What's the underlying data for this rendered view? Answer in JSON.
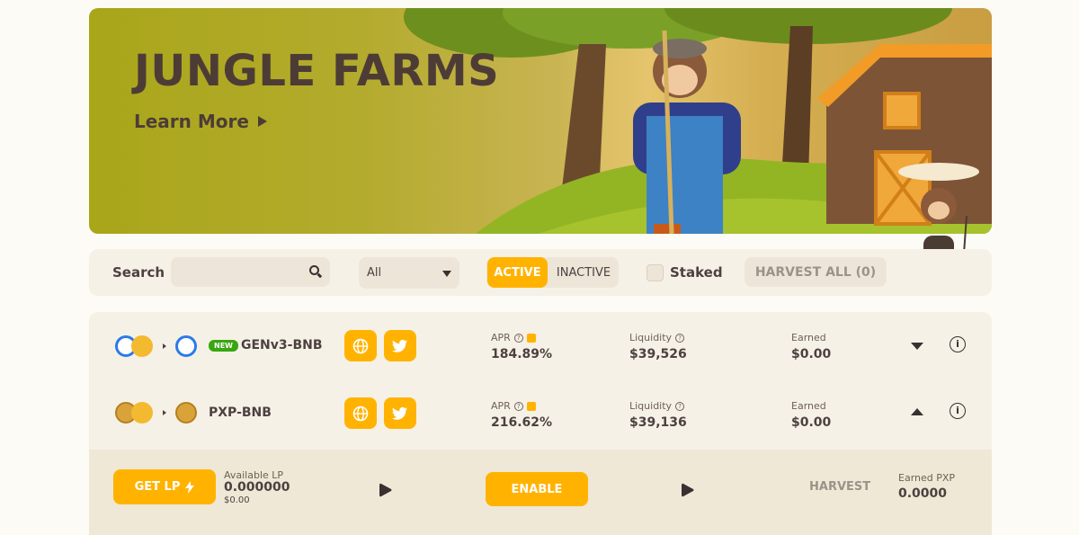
{
  "banner": {
    "title": "JUNGLE FARMS",
    "learn_more": "Learn More"
  },
  "controls": {
    "search_label": "Search",
    "search_placeholder": "",
    "filter_selected": "All",
    "active_label": "ACTIVE",
    "inactive_label": "INACTIVE",
    "staked_label": "Staked",
    "harvest_all_label": "HARVEST ALL (0)"
  },
  "farms": [
    {
      "badge": "NEW",
      "pair": "GENv3-BNB",
      "apr_label": "APR",
      "apr": "184.89%",
      "liquidity_label": "Liquidity",
      "liquidity": "$39,526",
      "earned_label": "Earned",
      "earned": "$0.00",
      "expanded": false
    },
    {
      "pair": "PXP-BNB",
      "apr_label": "APR",
      "apr": "216.62%",
      "liquidity_label": "Liquidity",
      "liquidity": "$39,136",
      "earned_label": "Earned",
      "earned": "$0.00",
      "expanded": true
    }
  ],
  "expanded_panel": {
    "get_lp_label": "GET LP",
    "available_lp_label": "Available LP",
    "available_lp": "0.000000",
    "available_lp_usd": "$0.00",
    "enable_label": "ENABLE",
    "harvest_label": "HARVEST",
    "earned_pxp_label": "Earned PXP",
    "earned_pxp": "0.0000"
  },
  "colors": {
    "accent": "#ffb300",
    "text": "#4d4040",
    "panel": "#f6f1e7",
    "new_badge": "#38a611"
  }
}
